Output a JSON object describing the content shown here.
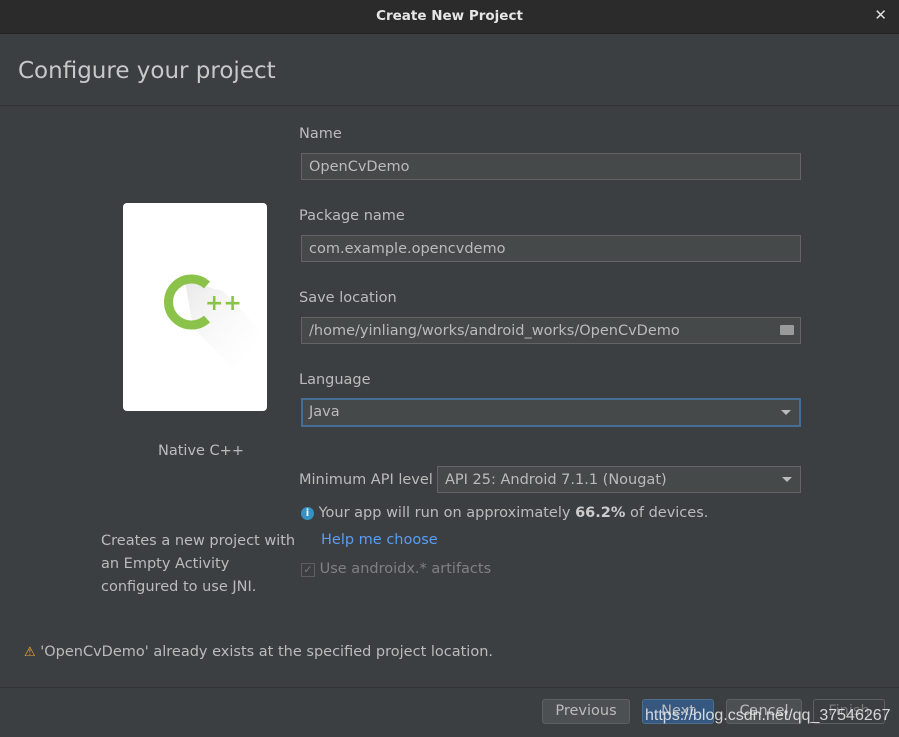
{
  "window": {
    "title": "Create New Project"
  },
  "header": {
    "title": "Configure your project"
  },
  "template": {
    "name": "Native C++",
    "description_lines": [
      "Creates a new project with",
      "an Empty Activity",
      "configured to use JNI."
    ],
    "logo_text": "C++"
  },
  "form": {
    "name_label": "Name",
    "name_value": "OpenCvDemo",
    "package_label": "Package name",
    "package_value": "com.example.opencvdemo",
    "location_label": "Save location",
    "location_value": "/home/yinliang/works/android_works/OpenCvDemo",
    "language_label": "Language",
    "language_value": "Java",
    "api_label": "Minimum API level",
    "api_value": "API 25: Android 7.1.1 (Nougat)",
    "info_prefix": "Your app will run on approximately ",
    "info_percent": "66.2%",
    "info_suffix": " of devices.",
    "help_link": "Help me choose",
    "androidx_label": "Use androidx.* artifacts",
    "androidx_checked": true
  },
  "warning": "'OpenCvDemo' already exists at the specified project location.",
  "buttons": {
    "previous": "Previous",
    "next": "Next",
    "cancel": "Cancel",
    "finish": "Finish"
  },
  "watermark": "https://blog.csdn.net/qq_37546267",
  "colors": {
    "accent": "#365880",
    "link": "#589df6",
    "logo": "#8bc34a",
    "warning": "#f0a732",
    "info": "#3592c4"
  }
}
